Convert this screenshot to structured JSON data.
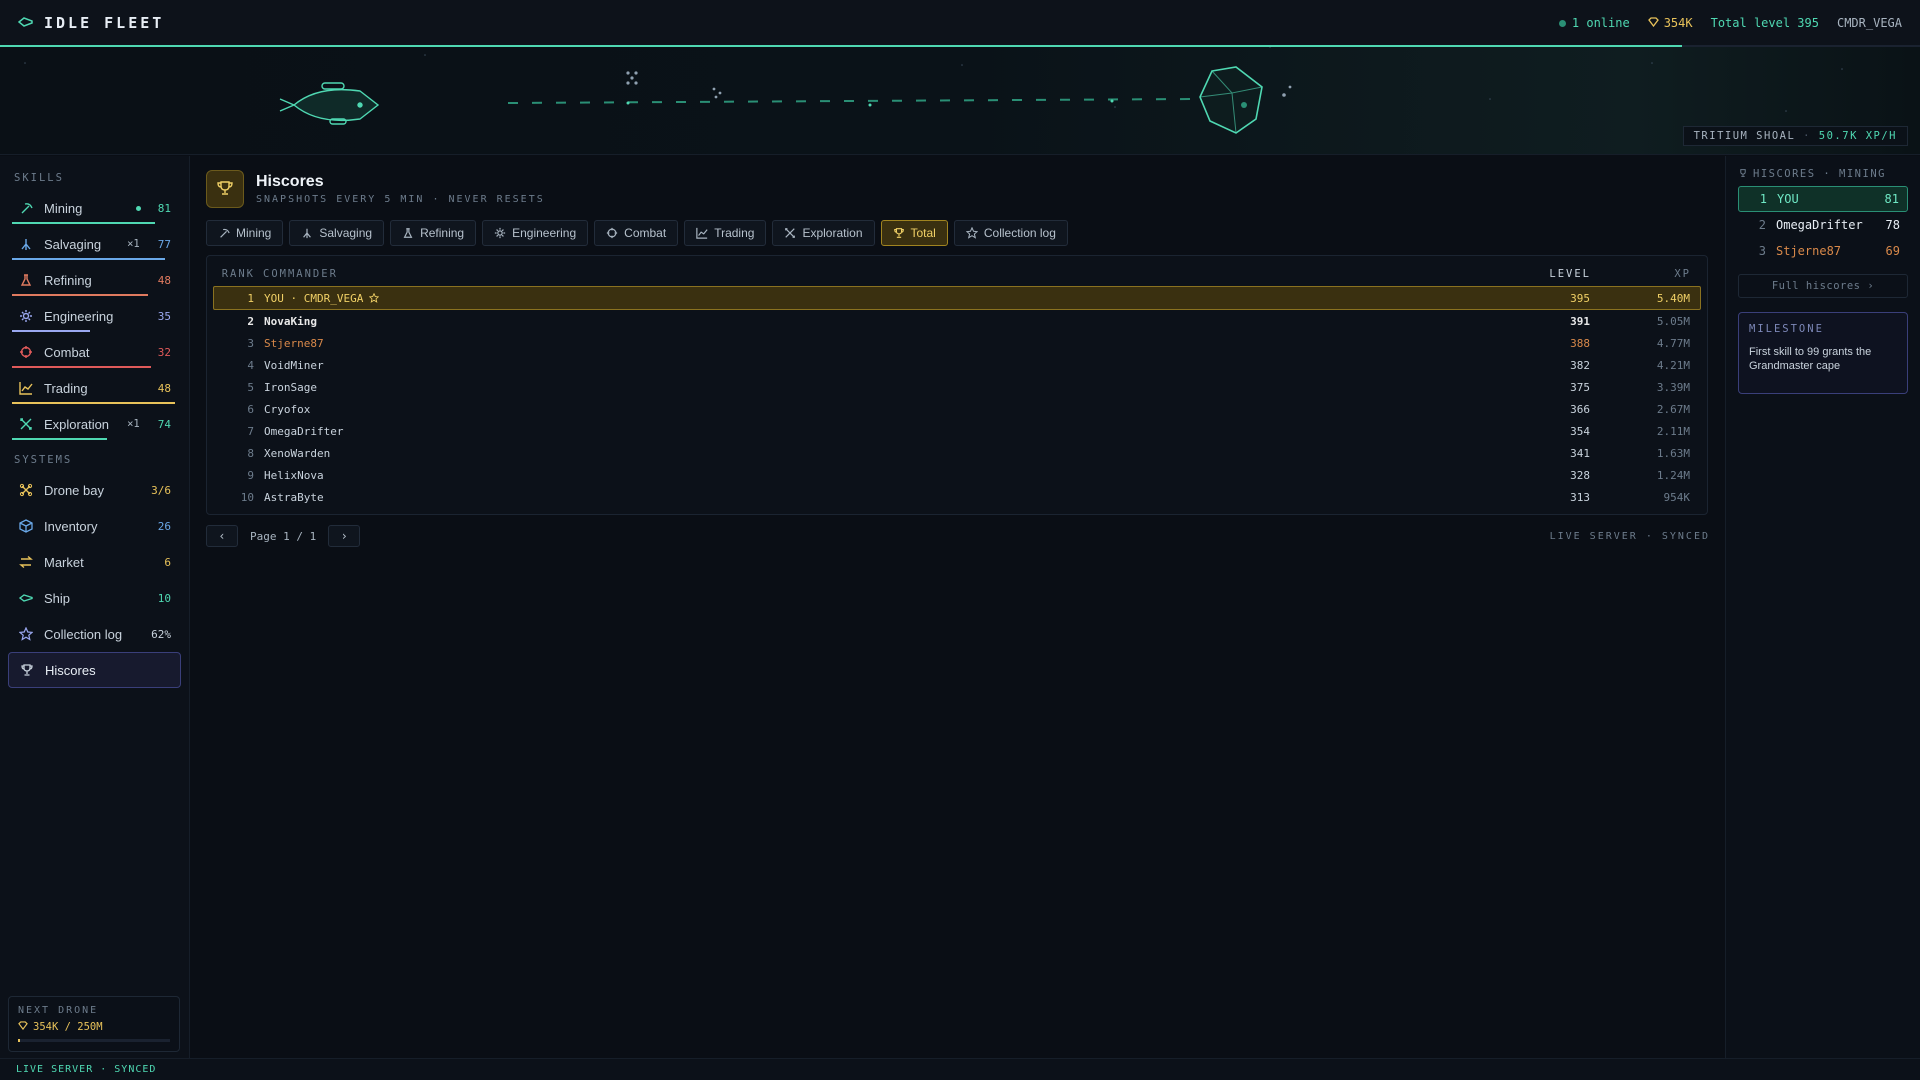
{
  "app": {
    "title": "IDLE FLEET"
  },
  "top": {
    "online": "1 online",
    "credits": "354K",
    "total_level": "Total level 395",
    "commander": "CMDR_VEGA",
    "total_progress": 0.876
  },
  "hero": {
    "zone": "TRITIUM SHOAL",
    "rate": "50.7K XP/H"
  },
  "sidebar": {
    "skills_heading": "SKILLS",
    "skills": [
      {
        "label": "Mining",
        "value": "81",
        "boost": "",
        "icon": "pickaxe-icon",
        "color": "#4fd8b2",
        "dot": true,
        "progress": 0.86
      },
      {
        "label": "Salvaging",
        "value": "77",
        "boost": "×1",
        "icon": "claw-icon",
        "color": "#6aa8e8",
        "dot": false,
        "progress": 0.92
      },
      {
        "label": "Refining",
        "value": "48",
        "boost": "",
        "icon": "flask-icon",
        "color": "#e07a5f",
        "dot": false,
        "progress": 0.82
      },
      {
        "label": "Engineering",
        "value": "35",
        "boost": "",
        "icon": "gear-icon",
        "color": "#9aa8f0",
        "dot": false,
        "progress": 0.47
      },
      {
        "label": "Combat",
        "value": "32",
        "boost": "",
        "icon": "crosshair-icon",
        "color": "#e05a5a",
        "dot": false,
        "progress": 0.84
      },
      {
        "label": "Trading",
        "value": "48",
        "boost": "",
        "icon": "trend-icon",
        "color": "#e8c25a",
        "dot": false,
        "progress": 0.98
      },
      {
        "label": "Exploration",
        "value": "74",
        "boost": "×1",
        "icon": "compass-icon",
        "color": "#4fd8b2",
        "dot": false,
        "progress": 0.57
      }
    ],
    "systems_heading": "SYSTEMS",
    "systems": [
      {
        "label": "Drone bay",
        "value": "3/6",
        "icon": "drone-icon",
        "color": "#e8c25a"
      },
      {
        "label": "Inventory",
        "value": "26",
        "icon": "box-icon",
        "color": "#6aa8e8"
      },
      {
        "label": "Market",
        "value": "6",
        "icon": "exchange-icon",
        "color": "#e8c25a"
      },
      {
        "label": "Ship",
        "value": "10",
        "icon": "ship-icon",
        "color": "#4fd8b2"
      },
      {
        "label": "Collection log",
        "value": "62%",
        "icon": "star-icon",
        "color": "#c9d3dd"
      },
      {
        "label": "Hiscores",
        "value": "",
        "icon": "trophy-icon",
        "color": "#c9d3dd",
        "active": true
      }
    ],
    "next_drone": {
      "title": "NEXT DRONE",
      "value": "354K / 250M",
      "progress": 0.0014
    }
  },
  "main": {
    "title": "Hiscores",
    "subtitle": "SNAPSHOTS EVERY 5 MIN · NEVER RESETS",
    "tabs": [
      {
        "label": "Mining",
        "icon": "pickaxe-icon"
      },
      {
        "label": "Salvaging",
        "icon": "claw-icon"
      },
      {
        "label": "Refining",
        "icon": "flask-icon"
      },
      {
        "label": "Engineering",
        "icon": "gear-icon"
      },
      {
        "label": "Combat",
        "icon": "crosshair-icon"
      },
      {
        "label": "Trading",
        "icon": "trend-icon"
      },
      {
        "label": "Exploration",
        "icon": "compass-icon"
      },
      {
        "label": "Total",
        "icon": "trophy-icon",
        "active": true
      },
      {
        "label": "Collection log",
        "icon": "star-icon"
      }
    ],
    "table": {
      "headers": {
        "rank": "RANK",
        "commander": "COMMANDER",
        "level": "LEVEL",
        "xp": "XP"
      },
      "rows": [
        {
          "rank": "1",
          "name": "YOU · CMDR_VEGA",
          "level": "395",
          "xp": "5.40M",
          "me": true
        },
        {
          "rank": "2",
          "name": "NovaKing",
          "level": "391",
          "xp": "5.05M",
          "tier": "gold"
        },
        {
          "rank": "3",
          "name": "Stjerne87",
          "level": "388",
          "xp": "4.77M",
          "tier": "bronze"
        },
        {
          "rank": "4",
          "name": "VoidMiner",
          "level": "382",
          "xp": "4.21M"
        },
        {
          "rank": "5",
          "name": "IronSage",
          "level": "375",
          "xp": "3.39M"
        },
        {
          "rank": "6",
          "name": "Cryofox",
          "level": "366",
          "xp": "2.67M"
        },
        {
          "rank": "7",
          "name": "OmegaDrifter",
          "level": "354",
          "xp": "2.11M"
        },
        {
          "rank": "8",
          "name": "XenoWarden",
          "level": "341",
          "xp": "1.63M"
        },
        {
          "rank": "9",
          "name": "HelixNova",
          "level": "328",
          "xp": "1.24M"
        },
        {
          "rank": "10",
          "name": "AstraByte",
          "level": "313",
          "xp": "954K"
        }
      ]
    },
    "pager": {
      "prev": "‹",
      "info": "Page 1 / 1",
      "next": "›",
      "status": "LIVE SERVER · SYNCED"
    }
  },
  "right": {
    "heading": "HISCORES · MINING",
    "rows": [
      {
        "rank": "1",
        "name": "YOU",
        "level": "81",
        "me": true
      },
      {
        "rank": "2",
        "name": "OmegaDrifter",
        "level": "78"
      },
      {
        "rank": "3",
        "name": "Stjerne87",
        "level": "69",
        "tier": "bronze"
      }
    ],
    "full_link": "Full hiscores ›",
    "milestone": {
      "title": "MILESTONE",
      "body": "First skill to 99 grants the Grandmaster cape"
    }
  },
  "footer": {
    "status": "LIVE SERVER · SYNCED"
  },
  "colors": {
    "accent": "#4fd8b2",
    "gold": "#f0d066",
    "bronze": "#d9894a",
    "indigo": "#3a3f7a"
  }
}
